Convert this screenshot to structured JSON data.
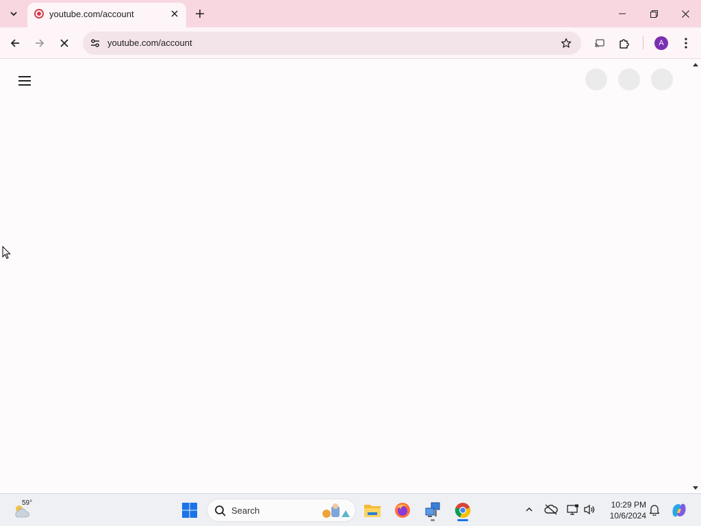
{
  "browser": {
    "tab": {
      "title": "youtube.com/account"
    },
    "address_bar": {
      "url": "youtube.com/account"
    },
    "profile_initial": "A"
  },
  "taskbar": {
    "weather": {
      "temperature": "59°"
    },
    "search": {
      "label": "Search"
    },
    "clock": {
      "time": "10:29 PM",
      "date": "10/6/2024"
    }
  }
}
